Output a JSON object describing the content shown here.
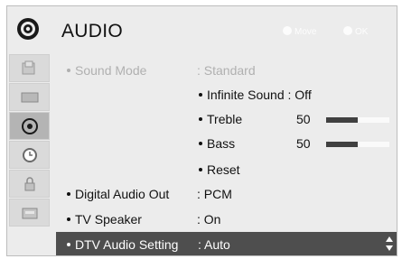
{
  "header": {
    "title": "AUDIO",
    "hint_move": "Move",
    "hint_ok": "OK"
  },
  "sidebar": {
    "items": [
      {
        "icon": "picture-icon"
      },
      {
        "icon": "screen-icon"
      },
      {
        "icon": "audio-icon",
        "active": true
      },
      {
        "icon": "time-icon"
      },
      {
        "icon": "lock-icon"
      },
      {
        "icon": "options-icon"
      }
    ]
  },
  "menu": {
    "sound_mode": {
      "label": "Sound Mode",
      "value": ": Standard"
    },
    "infinite_sound": {
      "label": "Infinite Sound : Off"
    },
    "treble": {
      "label": "Treble",
      "value": "50",
      "level": 0.5
    },
    "bass": {
      "label": "Bass",
      "value": "50",
      "level": 0.5
    },
    "reset": {
      "label": "Reset"
    },
    "digital_audio_out": {
      "label": "Digital Audio Out",
      "value": ": PCM"
    },
    "tv_speaker": {
      "label": "TV Speaker",
      "value": ": On"
    },
    "dtv_audio_setting": {
      "label": "DTV Audio Setting",
      "value": ": Auto"
    }
  },
  "colors": {
    "panel_bg": "#ececec",
    "selected_bg": "#4e4e4e",
    "bar_fill": "#404040",
    "disabled_text": "#b0b0b0"
  }
}
